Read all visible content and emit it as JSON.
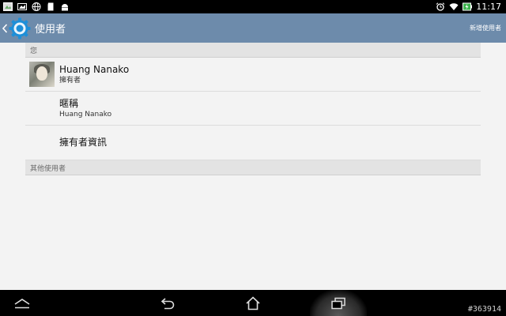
{
  "status_bar": {
    "time": "11:17",
    "left_icons": [
      "photo-notification-icon",
      "gallery-notification-icon",
      "globe-notification-icon",
      "sd-card-icon",
      "android-icon"
    ],
    "right_icons": [
      "alarm-icon",
      "wifi-icon",
      "battery-charging-icon"
    ]
  },
  "action_bar": {
    "title": "使用者",
    "action_label": "新增使用者",
    "background": "#6d8bab"
  },
  "sections": {
    "you_header": "您",
    "others_header": "其他使用者"
  },
  "owner": {
    "name": "Huang Nanako",
    "role": "擁有者"
  },
  "nickname": {
    "label": "暱稱",
    "value": "Huang Nanako"
  },
  "owner_info": {
    "label": "擁有者資訊"
  },
  "watermark": "#363914"
}
